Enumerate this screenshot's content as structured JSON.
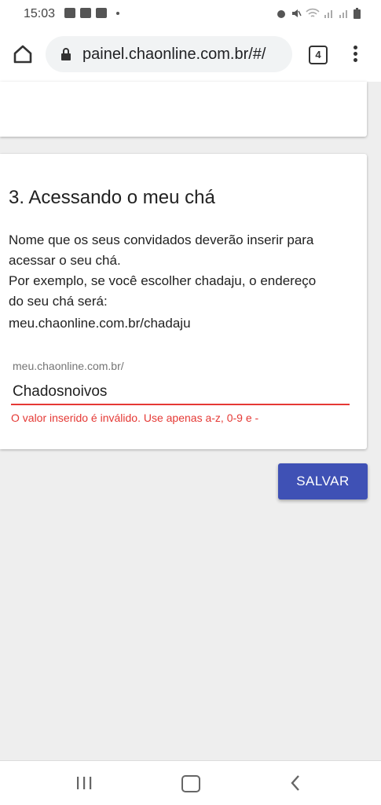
{
  "status_bar": {
    "time": "15:03",
    "left_icons": [
      "image-icon",
      "facebook-icon",
      "youtube-icon",
      "dot-icon"
    ],
    "right_icons": [
      "alarm-icon",
      "mute-icon",
      "wifi-icon",
      "signal-icon",
      "signal-icon",
      "battery-icon"
    ]
  },
  "browser": {
    "url": "painel.chaonline.com.br/#/",
    "tab_count": "4"
  },
  "section": {
    "title": "3. Acessando o meu chá",
    "description_lines": [
      "Nome que os seus convidados deverão inserir para",
      "acessar o seu chá.",
      "Por exemplo, se você escolher chadaju, o endereço",
      "do seu chá será:",
      "meu.chaonline.com.br/chadaju"
    ]
  },
  "field": {
    "label": "meu.chaonline.com.br/",
    "value": "Chadosnoivos",
    "error": "O valor inserido é inválido. Use apenas a-z, 0-9 e -",
    "error_color": "#e53935"
  },
  "actions": {
    "save_label": "SALVAR",
    "save_color": "#3f51b5"
  },
  "nav": {
    "icons": [
      "recent-apps-icon",
      "home-icon",
      "back-icon"
    ]
  }
}
